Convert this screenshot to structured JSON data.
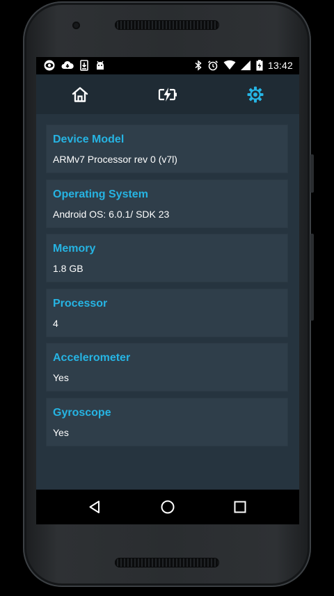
{
  "status_bar": {
    "time": "13:42",
    "left_icons": [
      "eye-icon",
      "cloud-download-icon",
      "download-icon",
      "android-icon"
    ],
    "right_icons": [
      "bluetooth-icon",
      "alarm-icon",
      "wifi-icon",
      "cell-signal-icon",
      "battery-charging-icon"
    ]
  },
  "toolbar": {
    "tabs": [
      {
        "icon": "home-icon",
        "active": false
      },
      {
        "icon": "battery-charging-icon",
        "active": false
      },
      {
        "icon": "gear-icon",
        "active": true
      }
    ]
  },
  "device_info": [
    {
      "title": "Device Model",
      "value": "ARMv7 Processor rev 0 (v7l)"
    },
    {
      "title": "Operating System",
      "value": "Android OS: 6.0.1/ SDK 23"
    },
    {
      "title": "Memory",
      "value": "1.8 GB"
    },
    {
      "title": "Processor",
      "value": "4"
    },
    {
      "title": "Accelerometer",
      "value": "Yes"
    },
    {
      "title": "Gyroscope",
      "value": "Yes"
    }
  ],
  "nav_bar": {
    "buttons": [
      "back-icon",
      "home-circle-icon",
      "recents-icon"
    ]
  },
  "colors": {
    "accent": "#26b4e3",
    "background": "#26343f",
    "card": "#2f3e4a",
    "toolbar": "#1f2b34"
  }
}
